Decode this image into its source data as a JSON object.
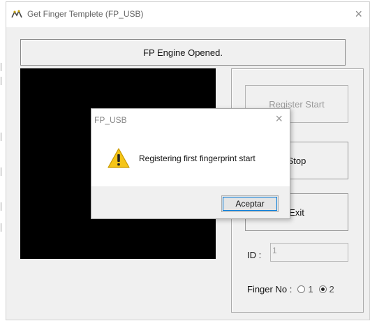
{
  "window": {
    "title": "Get Finger Templete (FP_USB)",
    "close_glyph": "×"
  },
  "status": "FP Engine Opened.",
  "buttons": {
    "register_start": "Register Start",
    "stop": "Stop",
    "exit": "Exit"
  },
  "id_field": {
    "label": "ID :",
    "value": "1"
  },
  "finger_no": {
    "label": "Finger No :",
    "options": [
      "1",
      "2"
    ],
    "selected": "2"
  },
  "dialog": {
    "title": "FP_USB",
    "close_glyph": "×",
    "message": "Registering first fingerprint start",
    "accept_label": "Aceptar",
    "icon": "warning-icon"
  },
  "colors": {
    "window_bg": "#f0f0f0",
    "preview_bg": "#000000",
    "warning_yellow": "#f5c518",
    "focus_blue": "#0078d7"
  }
}
